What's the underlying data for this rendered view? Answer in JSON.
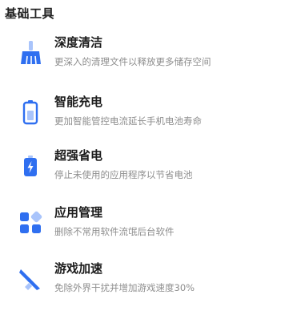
{
  "section": {
    "title": "基础工具"
  },
  "tools": [
    {
      "name": "深度清洁",
      "description": "更深入的清理文件以释放更多储存空间",
      "icon": "broom-icon"
    },
    {
      "name": "智能充电",
      "description": "更加智能管控电流延长手机电池寿命",
      "icon": "battery-icon"
    },
    {
      "name": "超强省电",
      "description": "停止未使用的应用程序以节省电池",
      "icon": "battery-bolt-icon"
    },
    {
      "name": "应用管理",
      "description": "删除不常用软件流氓后台软件",
      "icon": "app-grid-icon"
    },
    {
      "name": "游戏加速",
      "description": "免除外界干扰并增加游戏速度30%",
      "icon": "game-boost-icon"
    }
  ],
  "colors": {
    "accent": "#2f6ff0",
    "accent_light": "#a9c4fb",
    "title": "#1c1c1c",
    "subtitle": "#8e8e8e"
  }
}
